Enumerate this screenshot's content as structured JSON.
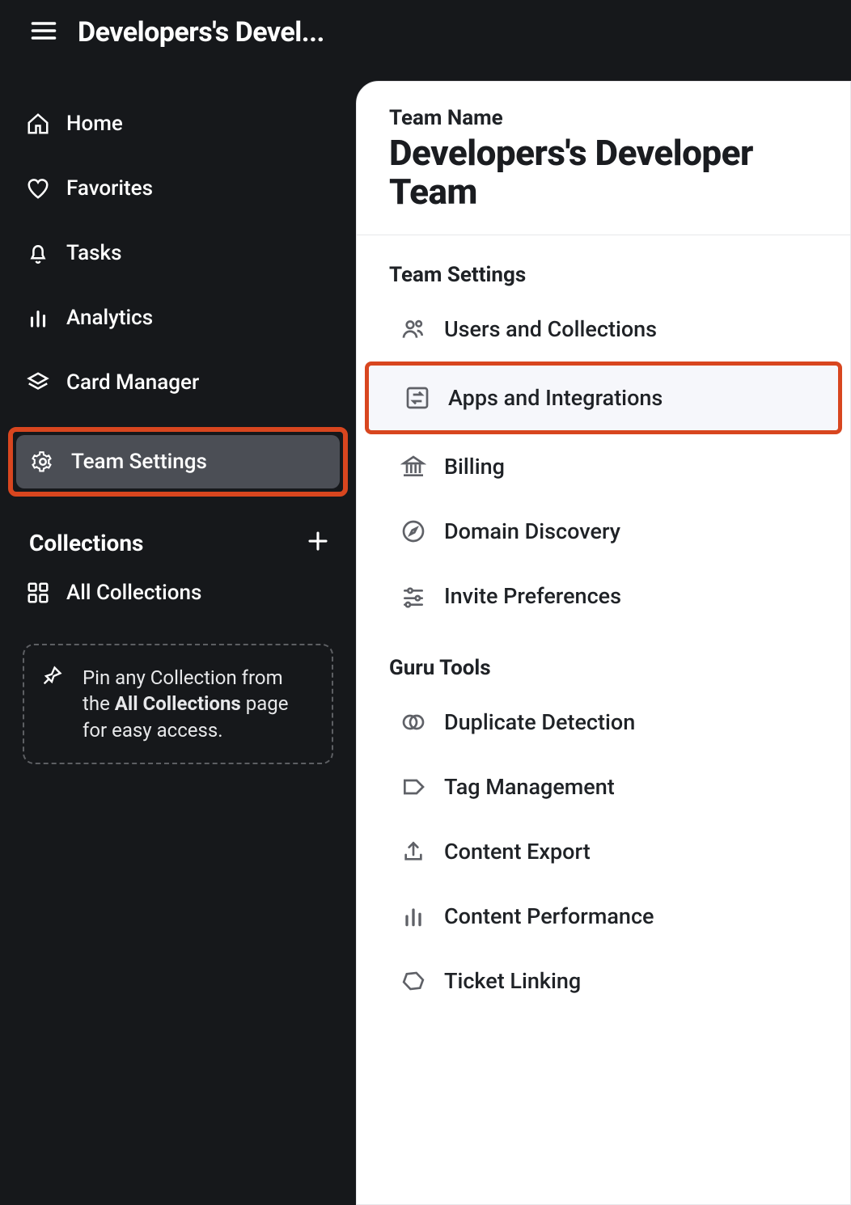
{
  "topbar": {
    "title": "Developers's Devel..."
  },
  "sidebar": {
    "items": [
      {
        "label": "Home"
      },
      {
        "label": "Favorites"
      },
      {
        "label": "Tasks"
      },
      {
        "label": "Analytics"
      },
      {
        "label": "Card Manager"
      },
      {
        "label": "Team Settings"
      }
    ],
    "collections_label": "Collections",
    "all_collections_label": "All Collections",
    "pin_hint_1": "Pin any Collection from the ",
    "pin_hint_bold": "All Collections",
    "pin_hint_2": " page for easy access."
  },
  "panel": {
    "eyebrow": "Team Name",
    "team_name": "Developers's Developer Team",
    "sections": [
      {
        "title": "Team Settings",
        "items": [
          {
            "label": "Users and Collections"
          },
          {
            "label": "Apps and Integrations"
          },
          {
            "label": "Billing"
          },
          {
            "label": "Domain Discovery"
          },
          {
            "label": "Invite Preferences"
          }
        ]
      },
      {
        "title": "Guru Tools",
        "items": [
          {
            "label": "Duplicate Detection"
          },
          {
            "label": "Tag Management"
          },
          {
            "label": "Content Export"
          },
          {
            "label": "Content Performance"
          },
          {
            "label": "Ticket Linking"
          }
        ]
      }
    ]
  }
}
